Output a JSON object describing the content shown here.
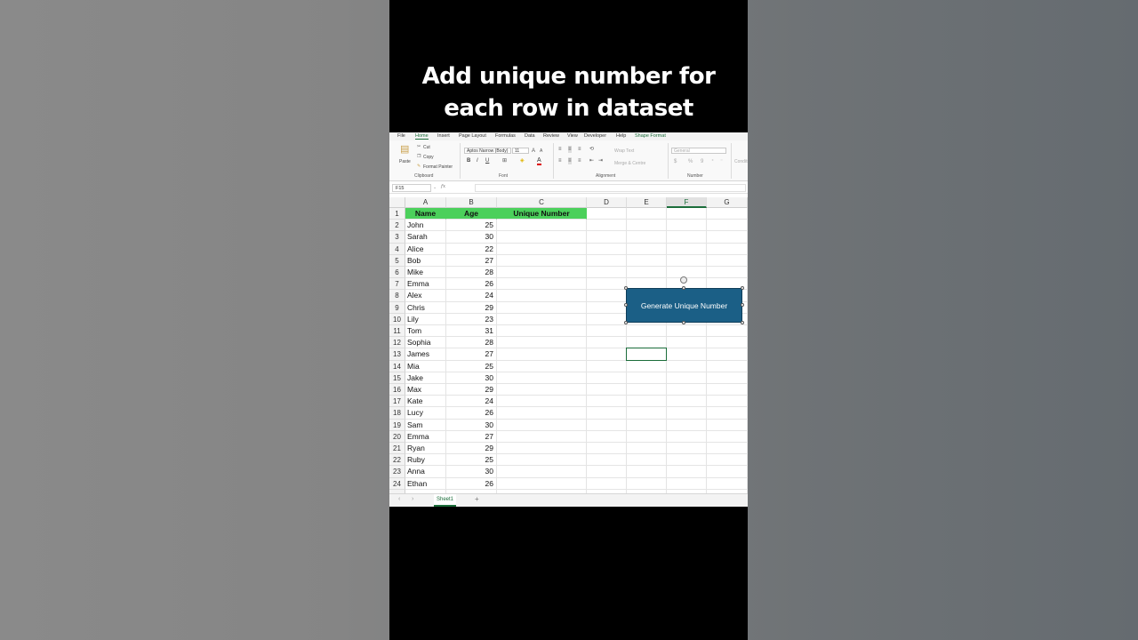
{
  "caption": {
    "line1": "Add unique number for",
    "line2": "each row in dataset"
  },
  "ribbon_tabs": [
    "File",
    "Home",
    "Insert",
    "Page Layout",
    "Formulas",
    "Data",
    "Review",
    "View",
    "Developer",
    "Help",
    "Shape Format"
  ],
  "ribbon": {
    "paste": "Paste",
    "cut": "Cut",
    "copy": "Copy",
    "format_painter": "Format Painter",
    "clipboard": "Clipboard",
    "font_name": "Aptos Narrow (Body)",
    "font_size": "11",
    "bold": "B",
    "italic": "I",
    "underline": "U",
    "font_color_letter": "A",
    "font": "Font",
    "wrap_text": "Wrap Text",
    "merge_center": "Merge & Centre",
    "alignment": "Alignment",
    "number_format": "General",
    "percent": "%",
    "number": "Number",
    "conditional": "Conditional Formatting"
  },
  "formula_bar": {
    "name_box": "F15",
    "fx": "fx",
    "content": ""
  },
  "columns": [
    "A",
    "B",
    "C",
    "D",
    "E",
    "F",
    "G"
  ],
  "header_row": {
    "name": "Name",
    "age": "Age",
    "unique": "Unique Number"
  },
  "rows": [
    {
      "name": "John",
      "age": "25"
    },
    {
      "name": "Sarah",
      "age": "30"
    },
    {
      "name": "Alice",
      "age": "22"
    },
    {
      "name": "Bob",
      "age": "27"
    },
    {
      "name": "Mike",
      "age": "28"
    },
    {
      "name": "Emma",
      "age": "26"
    },
    {
      "name": "Alex",
      "age": "24"
    },
    {
      "name": "Chris",
      "age": "29"
    },
    {
      "name": "Lily",
      "age": "23"
    },
    {
      "name": "Tom",
      "age": "31"
    },
    {
      "name": "Sophia",
      "age": "28"
    },
    {
      "name": "James",
      "age": "27"
    },
    {
      "name": "Mia",
      "age": "25"
    },
    {
      "name": "Jake",
      "age": "30"
    },
    {
      "name": "Max",
      "age": "29"
    },
    {
      "name": "Kate",
      "age": "24"
    },
    {
      "name": "Lucy",
      "age": "26"
    },
    {
      "name": "Sam",
      "age": "30"
    },
    {
      "name": "Emma",
      "age": "27"
    },
    {
      "name": "Ryan",
      "age": "29"
    },
    {
      "name": "Ruby",
      "age": "25"
    },
    {
      "name": "Anna",
      "age": "30"
    },
    {
      "name": "Ethan",
      "age": "26"
    }
  ],
  "shape_button": {
    "label": "Generate Unique Number"
  },
  "sheet_tabs": {
    "active": "Sheet1",
    "add": "+",
    "nav_prev": "‹",
    "nav_next": "›"
  },
  "colors": {
    "header_green": "#4bd05b",
    "shape_blue": "#1b5f86",
    "excel_green": "#1b6d3a"
  }
}
